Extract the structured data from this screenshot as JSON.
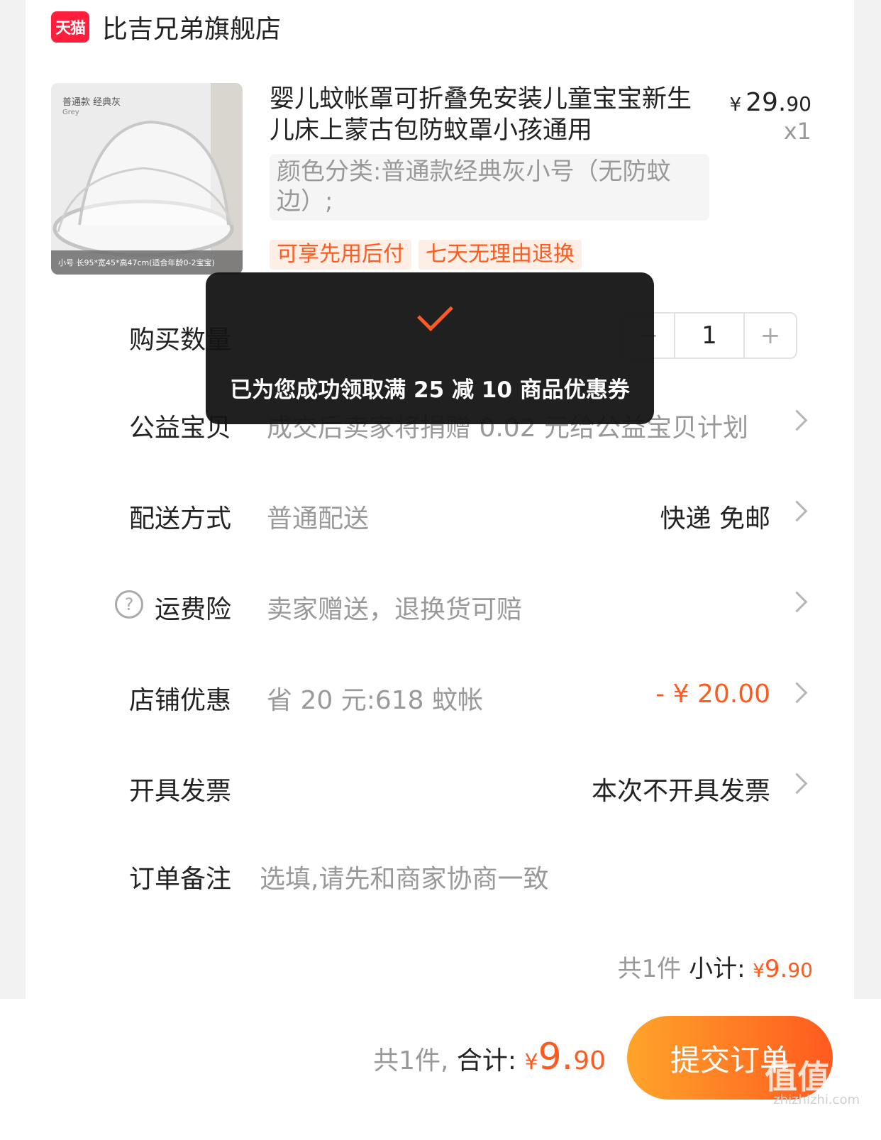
{
  "store": {
    "badge": "天猫",
    "name": "比吉兄弟旗舰店"
  },
  "product": {
    "thumb_top": "普通款  经典灰",
    "thumb_sub": "Grey",
    "thumb_bottom": "小号 长95*宽45*高47cm(适合年龄0-2宝宝)",
    "title": "婴儿蚊帐罩可折叠免安装儿童宝宝新生儿床上蒙古包防蚊罩小孩通用",
    "price_symbol": "¥",
    "price_int": "29.",
    "price_dec": "90",
    "quantity": "x1",
    "sku": "颜色分类:普通款经典灰小号（无防蚊边）;",
    "tags": [
      "可享先用后付",
      "七天无理由退换"
    ]
  },
  "rows": {
    "quantity": {
      "label": "购买数量",
      "minus": "−",
      "value": "1",
      "plus": "+"
    },
    "charity": {
      "label": "公益宝贝",
      "value": "成交后卖家将捐赠 0.02 元给公益宝贝计划"
    },
    "delivery": {
      "label": "配送方式",
      "value": "普通配送",
      "right": "快递 免邮"
    },
    "insurance": {
      "icon": "?",
      "label": "运费险",
      "value": "卖家赠送，退换货可赔"
    },
    "discount": {
      "label": "店铺优惠",
      "value": "省 20 元:618 蚊帐",
      "right": "- ¥ 20.00"
    },
    "invoice": {
      "label": "开具发票",
      "right": "本次不开具发票"
    },
    "note": {
      "label": "订单备注",
      "placeholder": "选填,请先和商家协商一致"
    }
  },
  "subtotal": {
    "count": "共1件",
    "label": "小计:",
    "symbol": "¥",
    "int": "9.",
    "dec": "90"
  },
  "footer": {
    "count": "共1件,",
    "label": "合计:",
    "symbol": "¥",
    "int": "9.",
    "dec": "90",
    "submit": "提交订单",
    "watermark": "值值值",
    "watermark_sub": "zhizhizhi.com"
  },
  "toast": {
    "message": "已为您成功领取满 25 减 10 商品优惠券"
  },
  "colors": {
    "accent": "#ff5a1f",
    "tmall_red": "#ff1f3d",
    "toast_bg": "#141414"
  }
}
